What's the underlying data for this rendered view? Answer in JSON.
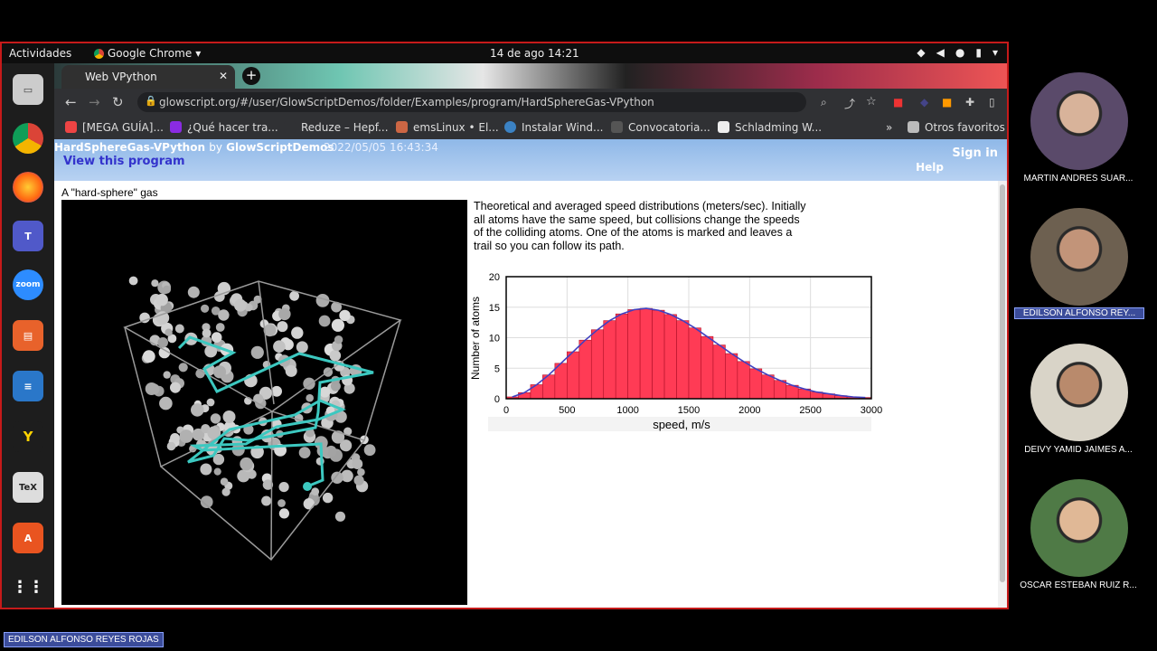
{
  "topbar": {
    "activities": "Actividades",
    "app": "Google Chrome",
    "clock": "14 de ago  14:21"
  },
  "browser": {
    "tab_title": "Web VPython",
    "url": "glowscript.org/#/user/GlowScriptDemos/folder/Examples/program/HardSphereGas-VPython",
    "bookmarks": [
      "[MEGA GUÍA]...",
      "¿Qué hacer tra...",
      "Reduze – Hepf...",
      "emsLinux • El...",
      "Instalar Wind...",
      "Convocatoria...",
      "Schladming W...",
      "Otros favoritos"
    ]
  },
  "glowscript": {
    "program": "HardSphereGas-VPython",
    "by": "by",
    "author": "GlowScriptDemos",
    "date": "2022/05/05 16:43:34",
    "view": "View this program",
    "sign_in": "Sign in",
    "help": "Help"
  },
  "page": {
    "caption": "A \"hard-sphere\" gas",
    "description": "Theoretical and averaged speed distributions (meters/sec). Initially all atoms have the same speed, but collisions change the speeds of the colliding atoms. One of the atoms is marked and leaves a trail so you can follow its path."
  },
  "chart_data": {
    "type": "bar",
    "xlabel": "speed, m/s",
    "ylabel": "Number of atoms",
    "xlim": [
      0,
      3000
    ],
    "ylim": [
      0,
      20
    ],
    "xticks": [
      0,
      500,
      1000,
      1500,
      2000,
      2500,
      3000
    ],
    "yticks": [
      0,
      5,
      10,
      15,
      20
    ],
    "bin_width": 100,
    "bins_start": [
      0,
      100,
      200,
      300,
      400,
      500,
      600,
      700,
      800,
      900,
      1000,
      1100,
      1200,
      1300,
      1400,
      1500,
      1600,
      1700,
      1800,
      1900,
      2000,
      2100,
      2200,
      2300,
      2400,
      2500,
      2600,
      2700,
      2800,
      2900
    ],
    "values": [
      0.3,
      1.0,
      2.3,
      3.9,
      5.8,
      7.7,
      9.6,
      11.3,
      12.8,
      13.9,
      14.6,
      14.8,
      14.5,
      13.8,
      12.8,
      11.6,
      10.2,
      8.8,
      7.4,
      6.1,
      4.9,
      3.9,
      3.0,
      2.2,
      1.6,
      1.1,
      0.8,
      0.5,
      0.3,
      0.2
    ],
    "bar_color": "#ff3b55",
    "curve_color": "#4040c0",
    "grid": true
  },
  "participants": [
    {
      "name": "MARTIN ANDRES SUAR...",
      "active": false,
      "bg": "#5a4a6a",
      "skin": "#d8b39a"
    },
    {
      "name": "EDILSON ALFONSO REY...",
      "active": true,
      "bg": "#6d6050",
      "skin": "#c29479"
    },
    {
      "name": "DEIVY YAMID JAIMES A...",
      "active": false,
      "bg": "#d9d4c8",
      "skin": "#b98a6c"
    },
    {
      "name": "OSCAR ESTEBAN RUIZ R...",
      "active": false,
      "bg": "#4f7a46",
      "skin": "#e0b896"
    }
  ],
  "presenter": "EDILSON ALFONSO REYES ROJAS"
}
